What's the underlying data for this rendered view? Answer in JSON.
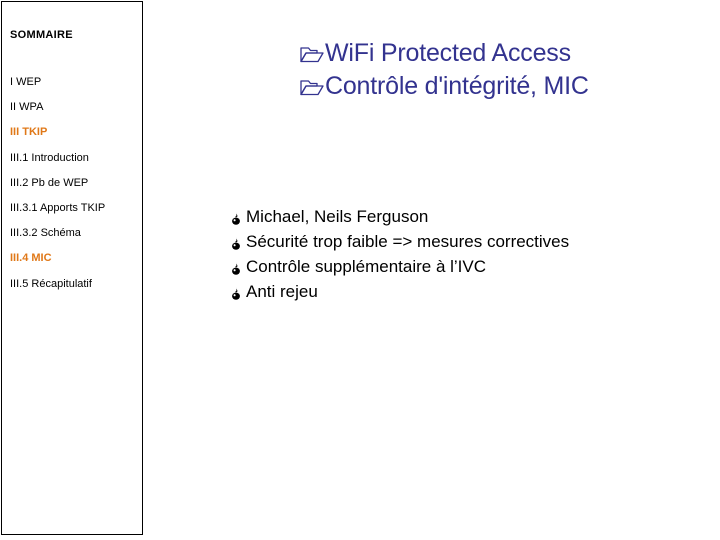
{
  "slide": {
    "background_color": "#FFFFFF",
    "accent_color": "#E07818",
    "title_color": "#33338F",
    "body_color": "#000000",
    "border_color": "#000000"
  },
  "sidebar": {
    "heading": "SOMMAIRE",
    "items": [
      {
        "label": "I WEP",
        "highlighted": false
      },
      {
        "label": "II WPA",
        "highlighted": false
      },
      {
        "label": "III TKIP",
        "highlighted": true
      },
      {
        "label": "III.1 Introduction",
        "highlighted": false
      },
      {
        "label": "III.2 Pb de WEP",
        "highlighted": false
      },
      {
        "label": "III.3.1 Apports TKIP",
        "highlighted": false
      },
      {
        "label": "III.3.2 Schéma",
        "highlighted": false
      },
      {
        "label": "III.4 MIC",
        "highlighted": true
      },
      {
        "label": "III.5 Récapitulatif",
        "highlighted": false
      }
    ]
  },
  "title": {
    "bullet_icon": "open-folder-icon",
    "lines": [
      "WiFi Protected Access",
      "Contrôle d'intégrité, MIC"
    ]
  },
  "body": {
    "bullet_icon": "flame-icon",
    "lines": [
      "Michael, Neils Ferguson",
      "Sécurité trop faible => mesures correctives",
      "Contrôle supplémentaire à l’IVC",
      "Anti rejeu"
    ]
  }
}
